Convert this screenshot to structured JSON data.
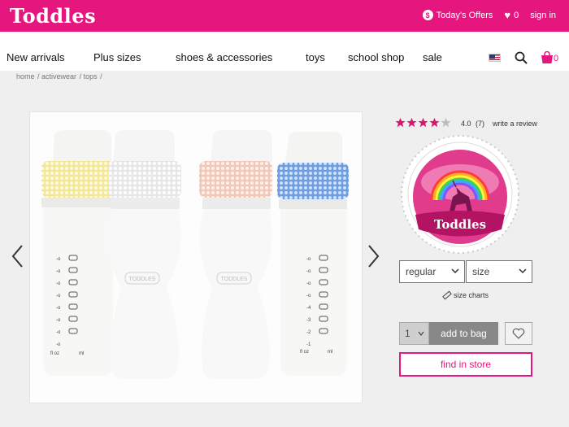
{
  "header": {
    "logo": "Toddles",
    "offers_label": "Today's Offers",
    "wishlist_count": "0",
    "signin_label": "sign in"
  },
  "nav": {
    "items": [
      "New arrivals",
      "Plus sizes",
      "shoes & accessories",
      "toys",
      "school shop",
      "sale"
    ],
    "bag_count": "0"
  },
  "breadcrumb": [
    "home",
    "activewear",
    "tops"
  ],
  "product": {
    "rating_value": "4.0",
    "rating_count": "(7)",
    "rating_stars": 4,
    "rating_max": 5,
    "write_review_label": "write a review",
    "badge_text": "Toddles",
    "fit_select": "regular",
    "size_select": "size",
    "size_charts_label": "size charts",
    "quantity": "1",
    "add_to_bag_label": "add to bag",
    "find_in_store_label": "find in store",
    "bottle_brand": "TODDLES",
    "bottle_scale_oz": [
      "8",
      "7",
      "6",
      "5",
      "4",
      "3",
      "2",
      "1"
    ],
    "bottle_scale_ml": [
      "240",
      "210",
      "180",
      "150",
      "120",
      "90",
      "60"
    ],
    "bottle_units": [
      "fl oz",
      "ml"
    ]
  },
  "colors": {
    "brand": "#e5177f",
    "star": "#d6186f",
    "button_grey": "#888888"
  },
  "icons": [
    "dollar-icon",
    "heart-icon",
    "flag-us-icon",
    "search-icon",
    "shopping-bag-icon",
    "chevron-left-icon",
    "chevron-right-icon",
    "chevron-down-icon",
    "ruler-icon",
    "wishlist-heart-icon"
  ]
}
